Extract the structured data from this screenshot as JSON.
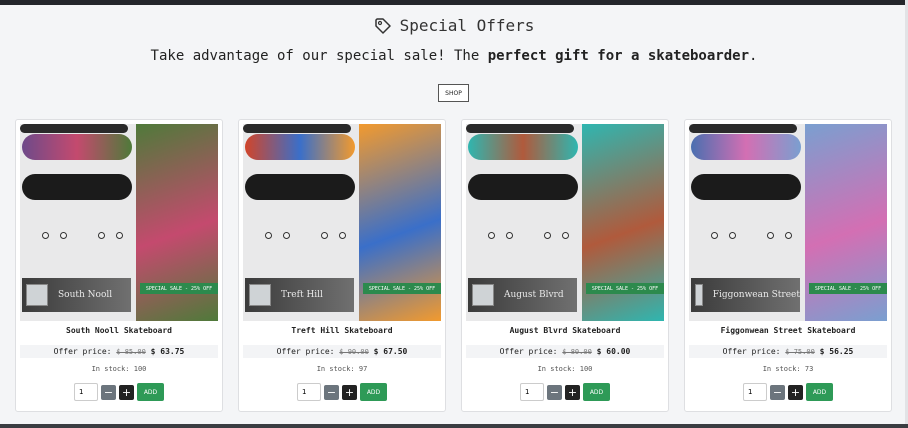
{
  "header": {
    "title": "Special Offers",
    "subtitle_plain": "Take advantage of our special sale! The ",
    "subtitle_bold": "perfect gift for a skateboarder",
    "subtitle_end": ".",
    "shop_label": "SHOP"
  },
  "labels": {
    "offer_price": "Offer price:",
    "in_stock": "In stock:",
    "add": "ADD",
    "minus": "−",
    "plus": "+",
    "sale_badge": "SPECIAL SALE - 25% OFF"
  },
  "products": [
    {
      "plate": "South Nooll",
      "name": "South Nooll Skateboard",
      "old_price": "$ 85.00",
      "new_price": "$ 63.75",
      "stock": "100",
      "qty": "1",
      "deck": "#6e4a8a",
      "wall1": "#4f7a3a",
      "wall2": "#c44a6e"
    },
    {
      "plate": "Treft Hill",
      "name": "Treft Hill Skateboard",
      "old_price": "$ 90.00",
      "new_price": "$ 67.50",
      "stock": "97",
      "qty": "1",
      "deck": "#d1452a",
      "wall1": "#f29a2e",
      "wall2": "#3a6fc9"
    },
    {
      "plate": "August Blvrd",
      "name": "August Blvrd Skateboard",
      "old_price": "$ 80.00",
      "new_price": "$ 60.00",
      "stock": "100",
      "qty": "1",
      "deck": "#2fb6b0",
      "wall1": "#2fb6b0",
      "wall2": "#b05a3c"
    },
    {
      "plate": "Figgonwean Street",
      "name": "Figgonwean Street Skateboard",
      "old_price": "$ 75.00",
      "new_price": "$ 56.25",
      "stock": "73",
      "qty": "1",
      "deck": "#4a6fb0",
      "wall1": "#7a9fd0",
      "wall2": "#d36fb3"
    }
  ]
}
